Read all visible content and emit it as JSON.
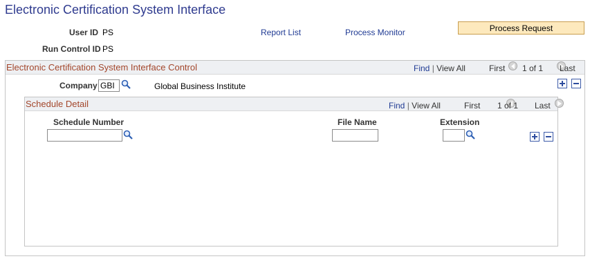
{
  "page": {
    "title": "Electronic Certification System Interface"
  },
  "header": {
    "user_id_label": "User ID",
    "user_id_value": "PS",
    "run_control_label": "Run Control ID",
    "run_control_value": "PS",
    "report_list": "Report List",
    "process_monitor": "Process Monitor",
    "process_request": "Process Request"
  },
  "control_section": {
    "title": "Electronic Certification System Interface Control",
    "find": "Find",
    "separator": "|",
    "view_all": "View All",
    "first": "First",
    "count": "1 of 1",
    "last": "Last",
    "company_label": "Company",
    "company_value": "GBI",
    "company_description": "Global Business Institute"
  },
  "schedule_section": {
    "title": "Schedule Detail",
    "find": "Find",
    "separator": "|",
    "view_all": "View All",
    "first": "First",
    "count": "1 of 1",
    "last": "Last",
    "columns": {
      "schedule_number": "Schedule Number",
      "file_name": "File Name",
      "extension": "Extension"
    },
    "row": {
      "schedule_number": "",
      "file_name": "",
      "extension": ""
    }
  },
  "colors": {
    "title": "#2f3b8f",
    "section_title": "#a3462b",
    "link": "#1f3a93",
    "button_bg": "#fde9bd"
  },
  "icons": [
    "lookup-icon",
    "prev-icon",
    "next-icon",
    "plus-icon",
    "minus-icon"
  ]
}
